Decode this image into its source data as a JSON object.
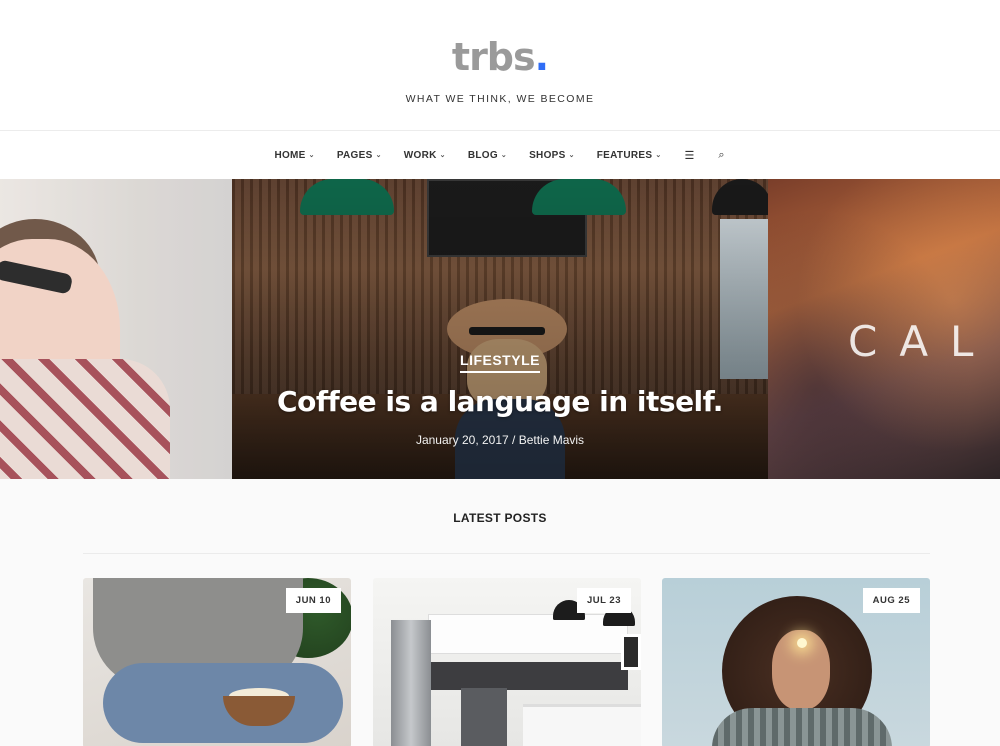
{
  "site": {
    "logo_text": "trbs",
    "logo_dot": ".",
    "tagline": "WHAT WE THINK, WE BECOME",
    "accent_color": "#2f6df6"
  },
  "nav": {
    "items": [
      {
        "label": "HOME"
      },
      {
        "label": "PAGES"
      },
      {
        "label": "WORK"
      },
      {
        "label": "BLOG"
      },
      {
        "label": "SHOPS"
      },
      {
        "label": "FEATURES"
      }
    ],
    "caret_glyph": "⌄",
    "menu_icon": "☰",
    "search_icon": "⌕"
  },
  "slider": {
    "current": {
      "category": "LIFESTYLE",
      "title": "Coffee is a language in itself.",
      "meta": "January 20, 2017 / Bettie Mavis"
    },
    "next_text": "CAL"
  },
  "latest": {
    "title": "LATEST POSTS",
    "posts": [
      {
        "date": "JUN 10"
      },
      {
        "date": "JUL 23"
      },
      {
        "date": "AUG 25"
      }
    ]
  }
}
